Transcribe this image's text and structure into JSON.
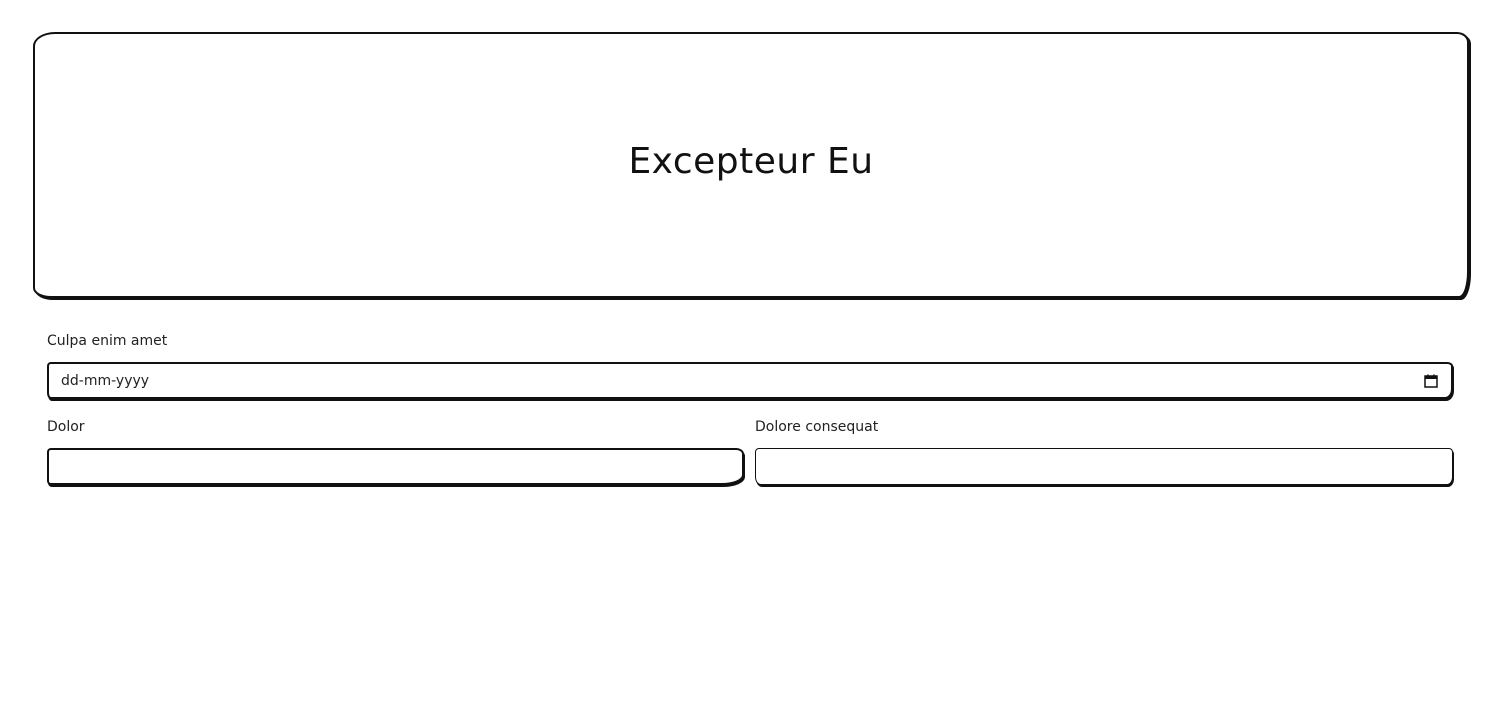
{
  "hero": {
    "title": "Excepteur Eu"
  },
  "fields": {
    "date_field": {
      "label": "Culpa enim amet",
      "placeholder": "dd-mm-yyyy",
      "icon": "calendar-icon"
    },
    "dolor_field": {
      "label": "Dolor",
      "value": ""
    },
    "consequat_field": {
      "label": "Dolore consequat",
      "value": ""
    }
  }
}
